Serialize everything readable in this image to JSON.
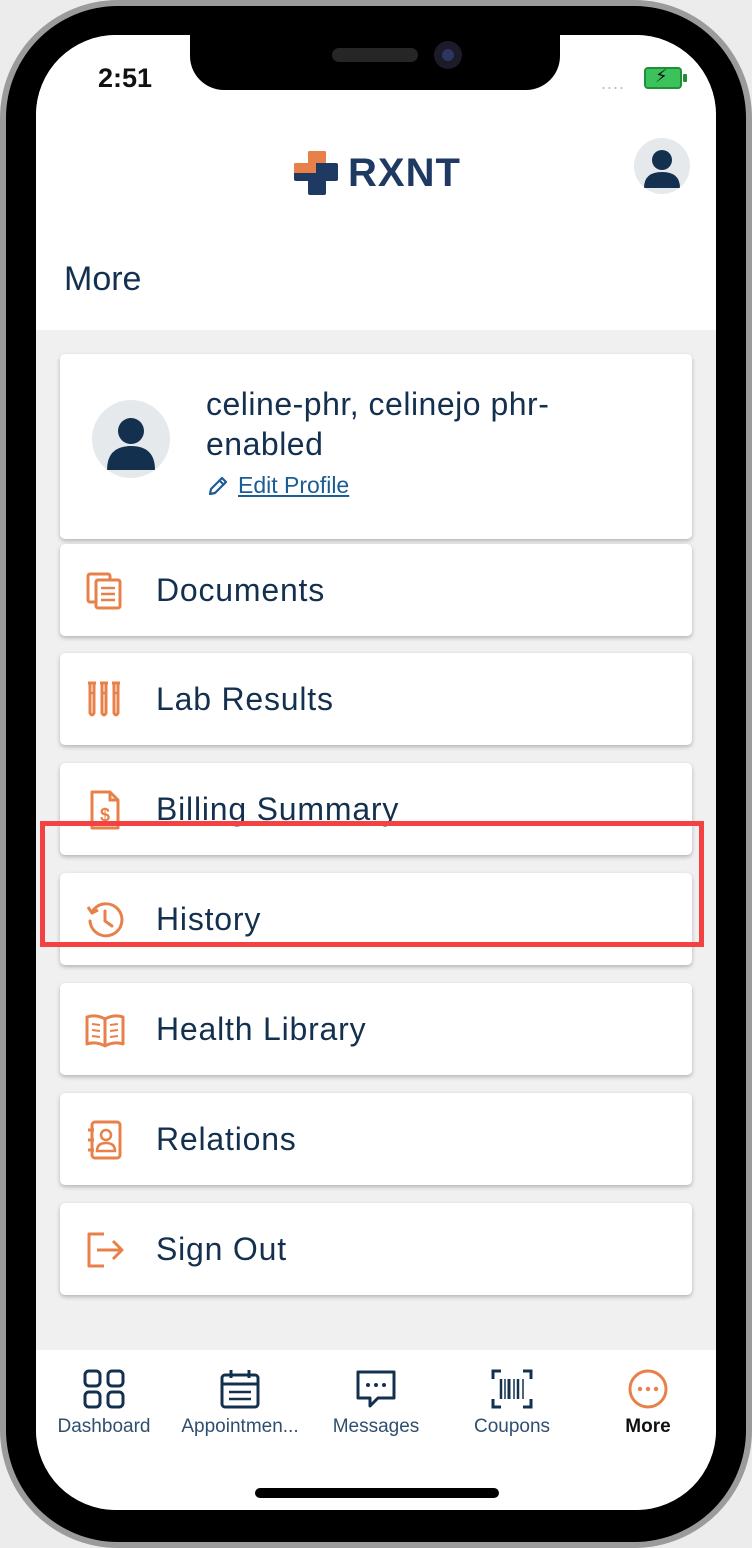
{
  "status_bar": {
    "time": "2:51",
    "signal_dots": "....",
    "battery_state": "charging"
  },
  "header": {
    "logo_text": "RXNT",
    "title": "More"
  },
  "profile": {
    "name": "celine-phr, celinejo phr-enabled",
    "edit_label": "Edit Profile"
  },
  "menu_items": [
    {
      "label": "Documents",
      "icon": "documents-icon"
    },
    {
      "label": "Lab Results",
      "icon": "test-tubes-icon"
    },
    {
      "label": "Billing Summary",
      "icon": "billing-document-icon"
    },
    {
      "label": "History",
      "icon": "history-icon"
    },
    {
      "label": "Health Library",
      "icon": "open-book-icon"
    },
    {
      "label": "Relations",
      "icon": "contacts-book-icon"
    },
    {
      "label": "Sign Out",
      "icon": "sign-out-icon"
    }
  ],
  "tabs": [
    {
      "label": "Dashboard",
      "icon": "grid-icon"
    },
    {
      "label": "Appointmen...",
      "icon": "calendar-icon"
    },
    {
      "label": "Messages",
      "icon": "chat-bubble-icon"
    },
    {
      "label": "Coupons",
      "icon": "barcode-icon"
    },
    {
      "label": "More",
      "icon": "more-dots-icon",
      "active": true
    }
  ],
  "colors": {
    "accent": "#e8804a",
    "navy": "#14304f",
    "logo_blue": "#1e3a63",
    "highlight": "#f24242",
    "link": "#1b5d94"
  }
}
